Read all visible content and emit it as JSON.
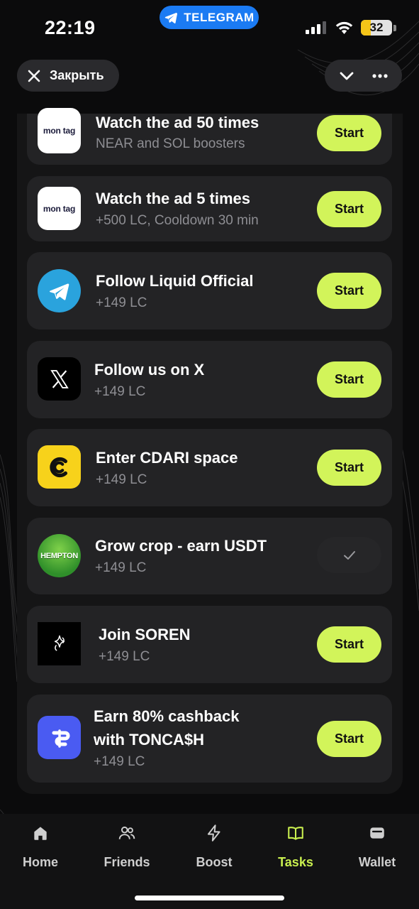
{
  "status_bar": {
    "time": "22:19",
    "telegram_label": "TELEGRAM",
    "battery_level": 32,
    "battery_text": "32"
  },
  "header": {
    "close_label": "Закрыть"
  },
  "tasks": [
    {
      "title": "Watch the ad 50 times",
      "subtitle": "NEAR and SOL boosters",
      "icon": "monetag-logo",
      "logo_text": "mon tag",
      "state": "start",
      "action_label": "Start"
    },
    {
      "title": "Watch the ad 5 times",
      "subtitle": "+500 LC, Cooldown 30 min",
      "icon": "monetag-logo",
      "logo_text": "mon tag",
      "state": "start",
      "action_label": "Start"
    },
    {
      "title": "Follow Liquid Official",
      "subtitle": "+149 LC",
      "icon": "telegram-icon",
      "state": "start",
      "action_label": "Start"
    },
    {
      "title": "Follow us on X",
      "subtitle": "+149 LC",
      "icon": "x-logo-icon",
      "state": "start",
      "action_label": "Start"
    },
    {
      "title": "Enter CDARI space",
      "subtitle": "+149 LC",
      "icon": "cdari-logo-icon",
      "state": "start",
      "action_label": "Start"
    },
    {
      "title": "Grow crop - earn USDT",
      "subtitle": "+149 LC",
      "icon": "hempton-logo",
      "logo_text": "HEMPTON",
      "state": "done",
      "action_label": ""
    },
    {
      "title": "Join SOREN",
      "subtitle": "+149 LC",
      "icon": "soren-logo-icon",
      "state": "start",
      "action_label": "Start"
    },
    {
      "title": "Earn 80% cashback",
      "title_line2": "with TONCA$H",
      "subtitle": "+149 LC",
      "icon": "toncash-logo-icon",
      "state": "start",
      "action_label": "Start"
    }
  ],
  "nav": {
    "items": [
      {
        "label": "Home",
        "icon": "home-icon",
        "active": false
      },
      {
        "label": "Friends",
        "icon": "friends-icon",
        "active": false
      },
      {
        "label": "Boost",
        "icon": "lightning-icon",
        "active": false
      },
      {
        "label": "Tasks",
        "icon": "book-icon",
        "active": true
      },
      {
        "label": "Wallet",
        "icon": "wallet-icon",
        "active": false
      }
    ]
  },
  "colors": {
    "accent": "#d2f45a",
    "active_tab": "#c9ef4f",
    "card_bg": "#232325",
    "telegram_blue": "#1b7bf3",
    "battery_fill": "#f5c518"
  }
}
